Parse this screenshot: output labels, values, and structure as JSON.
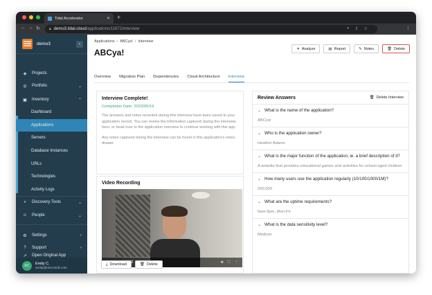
{
  "browser": {
    "tab_title": "Tidal Accelerator",
    "url_host": "demo3.tidal.cloud",
    "url_path": "/applications/11672/interview"
  },
  "sidebar": {
    "org": "demo3",
    "items": [
      {
        "label": "Projects",
        "icon": "projects-icon"
      },
      {
        "label": "Portfolio",
        "icon": "portfolio-icon"
      },
      {
        "label": "Inventory",
        "icon": "inventory-icon"
      }
    ],
    "inventory_children": [
      "Dashboard",
      "Applications",
      "Servers",
      "Database Instances",
      "URLs",
      "Technologies",
      "Activity Logs"
    ],
    "active_child": "Applications",
    "lower_items": [
      {
        "label": "Discovery Tools",
        "icon": "search-icon"
      },
      {
        "label": "People",
        "icon": "people-icon"
      }
    ],
    "bottom_items": [
      {
        "label": "Settings",
        "icon": "gear-icon"
      },
      {
        "label": "Support",
        "icon": "help-icon"
      },
      {
        "label": "Open Original App",
        "icon": "external-link-icon"
      }
    ],
    "user": {
      "initials": "EC",
      "name": "Emily C.",
      "email": "emily@microsoft.com"
    }
  },
  "header": {
    "breadcrumb": [
      "Applications",
      "ABCya!",
      "Interview"
    ],
    "title": "ABCya!",
    "actions": {
      "analyze": "Analyze",
      "report": "Report",
      "notes": "Notes",
      "delete": "Delete"
    }
  },
  "tabs": [
    "Overview",
    "Migration Plan",
    "Dependencies",
    "Cloud Architecture",
    "Interview"
  ],
  "active_tab": "Interview",
  "interview": {
    "title": "Interview Complete!",
    "completion": "Completion Date: 2023/05/19",
    "para1": "The answers and notes recorded during this interview have been saved to your application record. You can review the information captured during the interview here, or head over to the application overview to continue working with this app.",
    "para2": "Any notes captured during the interview can be found in this application's notes drawer."
  },
  "video": {
    "title": "Video Recording",
    "time": "0:01 / 37:02",
    "download": "Download",
    "delete": "Delete"
  },
  "review": {
    "title": "Review Answers",
    "delete_interview": "Delete Interview",
    "items": [
      {
        "q": "What is the name of the application?",
        "a": "ABCya!"
      },
      {
        "q": "Who is the application owner?",
        "a": "Heather Adams"
      },
      {
        "q": "What is the major function of the application, ie. a brief description of it?",
        "a": "A website that provides educational games and activities for school-aged children"
      },
      {
        "q": "How many users use the application regularly (10/100/1000/1M)?",
        "a": "200,000"
      },
      {
        "q": "What are the uptime requirements?",
        "a": "9am-5pm, Mon-Fri"
      },
      {
        "q": "What is the data sensitivity level?",
        "a": "Medium"
      }
    ]
  },
  "colors": {
    "sidebar": "#243d4d",
    "accent": "#2f85b6",
    "success": "#3aa675",
    "danger": "#d9534f"
  }
}
